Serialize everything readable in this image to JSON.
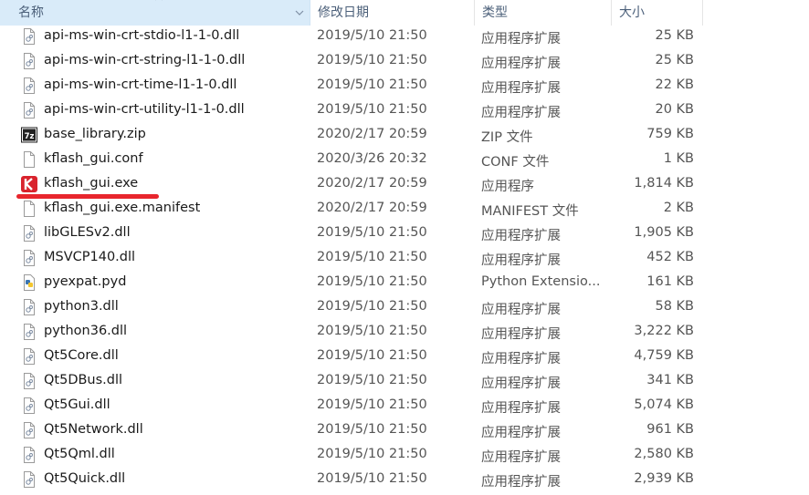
{
  "columns": {
    "name": "名称",
    "date": "修改日期",
    "type": "类型",
    "size": "大小"
  },
  "files": [
    {
      "name": "api-ms-win-crt-stdio-l1-1-0.dll",
      "date": "2019/5/10 21:50",
      "type": "应用程序扩展",
      "size": "25 KB",
      "icon": "dll-file-icon"
    },
    {
      "name": "api-ms-win-crt-string-l1-1-0.dll",
      "date": "2019/5/10 21:50",
      "type": "应用程序扩展",
      "size": "25 KB",
      "icon": "dll-file-icon"
    },
    {
      "name": "api-ms-win-crt-time-l1-1-0.dll",
      "date": "2019/5/10 21:50",
      "type": "应用程序扩展",
      "size": "22 KB",
      "icon": "dll-file-icon"
    },
    {
      "name": "api-ms-win-crt-utility-l1-1-0.dll",
      "date": "2019/5/10 21:50",
      "type": "应用程序扩展",
      "size": "20 KB",
      "icon": "dll-file-icon"
    },
    {
      "name": "base_library.zip",
      "date": "2020/2/17 20:59",
      "type": "ZIP 文件",
      "size": "759 KB",
      "icon": "7zip-archive-icon"
    },
    {
      "name": "kflash_gui.conf",
      "date": "2020/3/26 20:32",
      "type": "CONF 文件",
      "size": "1 KB",
      "icon": "blank-file-icon"
    },
    {
      "name": "kflash_gui.exe",
      "date": "2020/2/17 20:59",
      "type": "应用程序",
      "size": "1,814 KB",
      "icon": "kflash-app-icon"
    },
    {
      "name": "kflash_gui.exe.manifest",
      "date": "2020/2/17 20:59",
      "type": "MANIFEST 文件",
      "size": "2 KB",
      "icon": "blank-file-icon"
    },
    {
      "name": "libGLESv2.dll",
      "date": "2019/5/10 21:50",
      "type": "应用程序扩展",
      "size": "1,905 KB",
      "icon": "dll-file-icon"
    },
    {
      "name": "MSVCP140.dll",
      "date": "2019/5/10 21:50",
      "type": "应用程序扩展",
      "size": "452 KB",
      "icon": "dll-file-icon"
    },
    {
      "name": "pyexpat.pyd",
      "date": "2019/5/10 21:50",
      "type": "Python Extensio...",
      "size": "161 KB",
      "icon": "python-file-icon"
    },
    {
      "name": "python3.dll",
      "date": "2019/5/10 21:50",
      "type": "应用程序扩展",
      "size": "58 KB",
      "icon": "dll-file-icon"
    },
    {
      "name": "python36.dll",
      "date": "2019/5/10 21:50",
      "type": "应用程序扩展",
      "size": "3,222 KB",
      "icon": "dll-file-icon"
    },
    {
      "name": "Qt5Core.dll",
      "date": "2019/5/10 21:50",
      "type": "应用程序扩展",
      "size": "4,759 KB",
      "icon": "dll-file-icon"
    },
    {
      "name": "Qt5DBus.dll",
      "date": "2019/5/10 21:50",
      "type": "应用程序扩展",
      "size": "341 KB",
      "icon": "dll-file-icon"
    },
    {
      "name": "Qt5Gui.dll",
      "date": "2019/5/10 21:50",
      "type": "应用程序扩展",
      "size": "5,074 KB",
      "icon": "dll-file-icon"
    },
    {
      "name": "Qt5Network.dll",
      "date": "2019/5/10 21:50",
      "type": "应用程序扩展",
      "size": "961 KB",
      "icon": "dll-file-icon"
    },
    {
      "name": "Qt5Qml.dll",
      "date": "2019/5/10 21:50",
      "type": "应用程序扩展",
      "size": "2,580 KB",
      "icon": "dll-file-icon"
    },
    {
      "name": "Qt5Quick.dll",
      "date": "2019/5/10 21:50",
      "type": "应用程序扩展",
      "size": "2,939 KB",
      "icon": "dll-file-icon"
    }
  ],
  "colors": {
    "header_selected": "#d9ebf9",
    "header_text": "#4c607a",
    "highlight_underline": "#e8262d",
    "kflash_icon": "#d9232d"
  }
}
